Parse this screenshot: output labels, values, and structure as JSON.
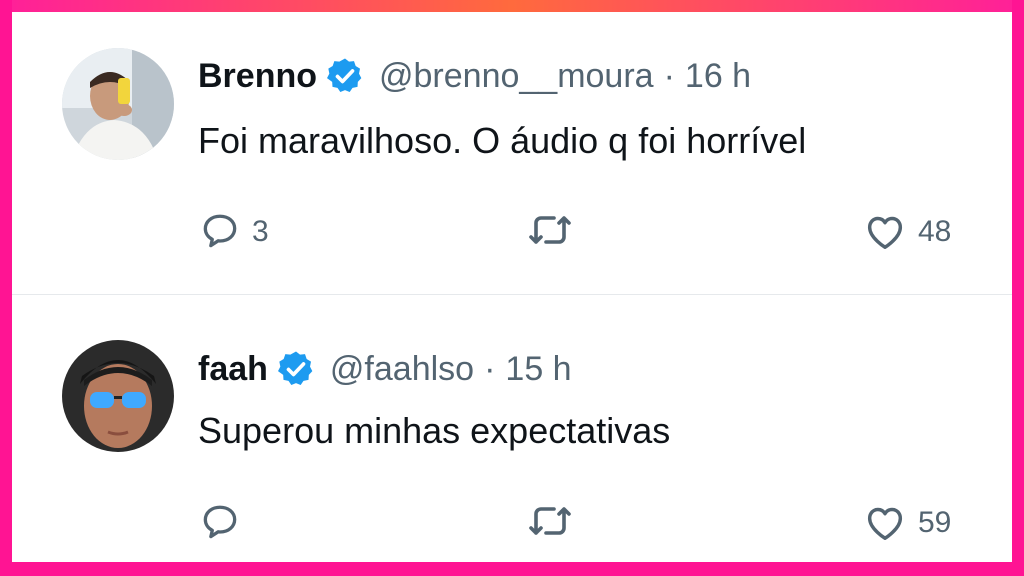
{
  "tweets": [
    {
      "name": "Brenno",
      "handle": "@brenno__moura",
      "separator": "·",
      "time": "16 h",
      "text": "Foi maravilhoso. O áudio q foi horrível",
      "replies": "3",
      "retweets": "",
      "likes": "48",
      "verified": true
    },
    {
      "name": "faah",
      "handle": "@faahlso",
      "separator": "·",
      "time": "15 h",
      "text": "Superou minhas expectativas",
      "replies": "",
      "retweets": "",
      "likes": "59",
      "verified": true
    }
  ],
  "icons": {
    "verified": "verified-badge-icon",
    "reply": "reply-icon",
    "retweet": "retweet-icon",
    "like": "heart-icon"
  },
  "colors": {
    "frame": "#ff1493",
    "verified": "#1d9bf0",
    "text": "#0f1419",
    "muted": "#536471",
    "divider": "#e6e9ec"
  }
}
